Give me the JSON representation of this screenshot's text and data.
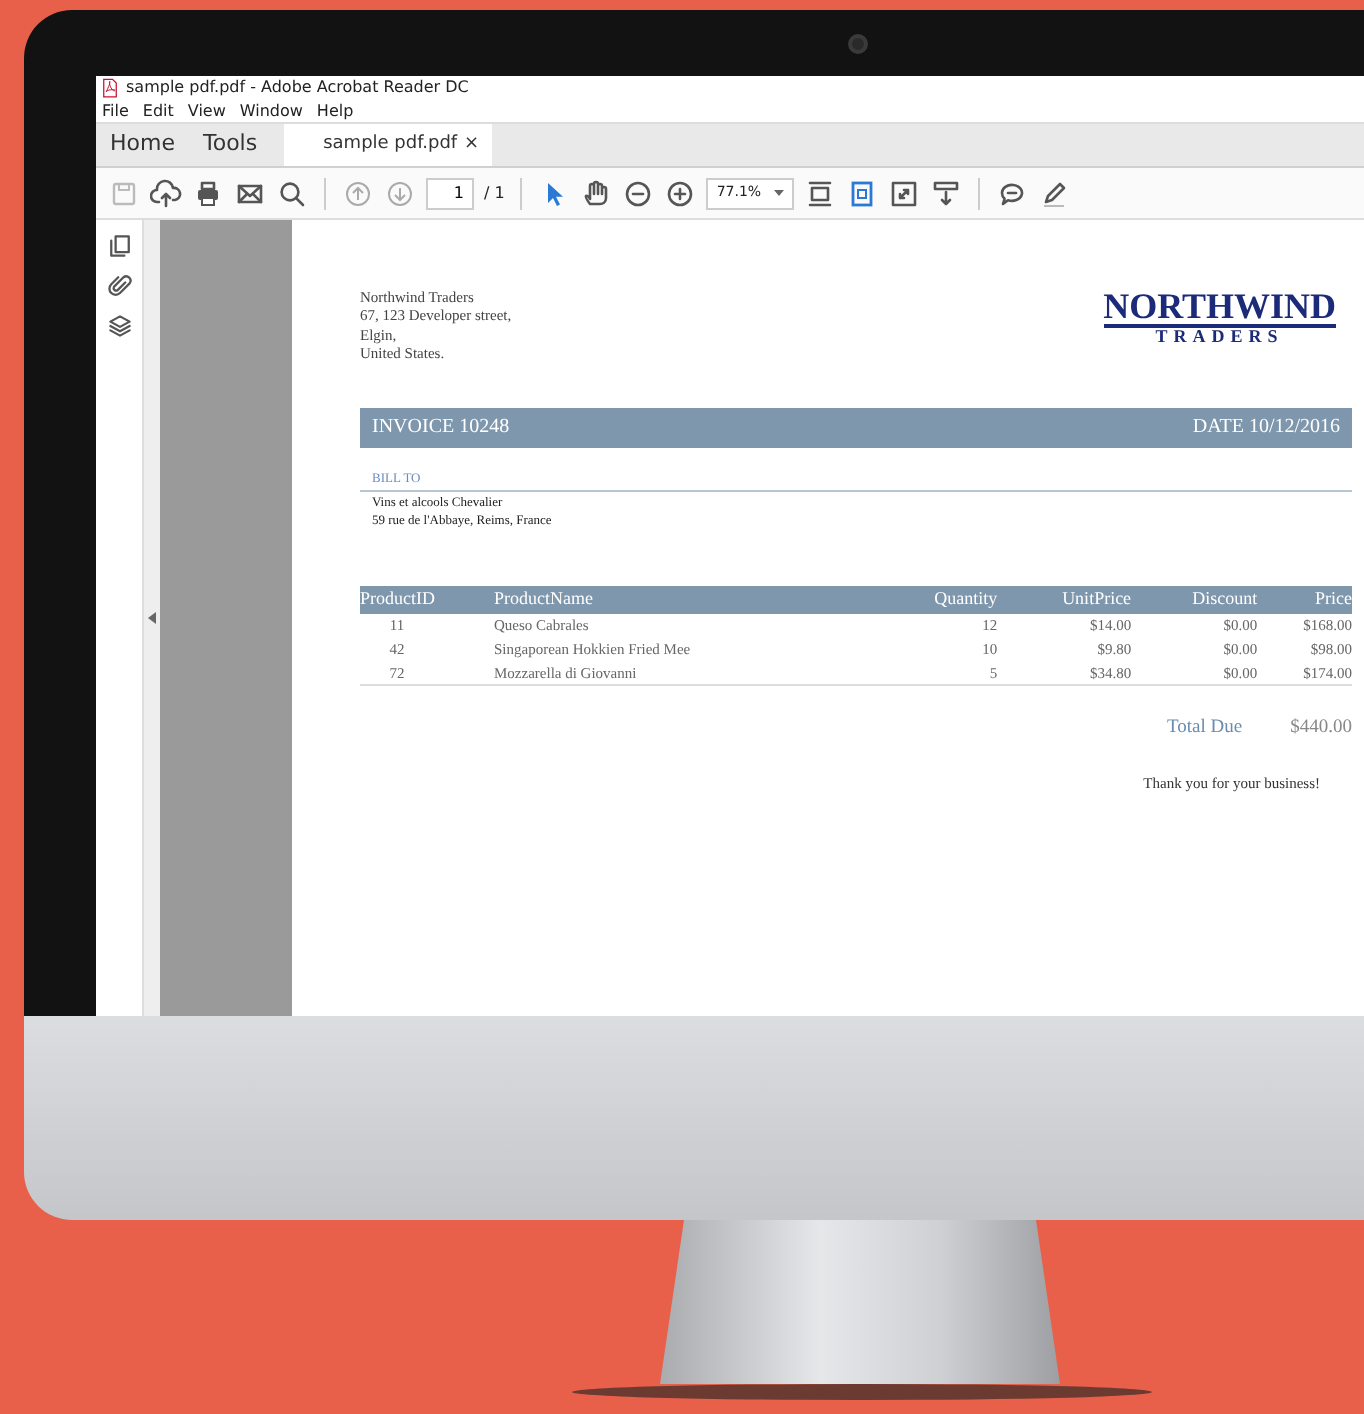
{
  "window": {
    "title": "sample pdf.pdf - Adobe Acrobat Reader DC"
  },
  "menu": [
    "File",
    "Edit",
    "View",
    "Window",
    "Help"
  ],
  "tabs": [
    {
      "label": "Home",
      "kind": "nav",
      "selected": false
    },
    {
      "label": "Tools",
      "kind": "nav",
      "selected": false
    },
    {
      "label": "sample pdf.pdf",
      "kind": "document",
      "selected": true,
      "close": "×"
    }
  ],
  "toolbar": {
    "page_number": "1",
    "page_count": "/ 1",
    "zoom": "77.1%"
  },
  "invoice": {
    "company": [
      "Northwind Traders",
      "67, 123 Developer street,",
      "Elgin,",
      "United States."
    ],
    "logo": {
      "title": "NORTHWIND",
      "subtitle": "TRADERS"
    },
    "number": "INVOICE 10248",
    "date": "DATE 10/12/2016",
    "bill_to": {
      "label": "BILL TO",
      "lines": [
        "Vins et alcools Chevalier",
        "59 rue de l'Abbaye, Reims, France"
      ]
    },
    "table": {
      "columns": [
        "ProductID",
        "ProductName",
        "Quantity",
        "UnitPrice",
        "Discount",
        "Price"
      ],
      "rows": [
        [
          "11",
          "Queso Cabrales",
          "12",
          "$14.00",
          "$0.00",
          "$168.00"
        ],
        [
          "42",
          "Singaporean Hokkien Fried Mee",
          "10",
          "$9.80",
          "$0.00",
          "$98.00"
        ],
        [
          "72",
          "Mozzarella di Giovanni",
          "5",
          "$34.80",
          "$0.00",
          "$174.00"
        ]
      ]
    },
    "total": {
      "label": "Total Due",
      "amount": "$440.00"
    },
    "thanks": "Thank you for your business!"
  }
}
